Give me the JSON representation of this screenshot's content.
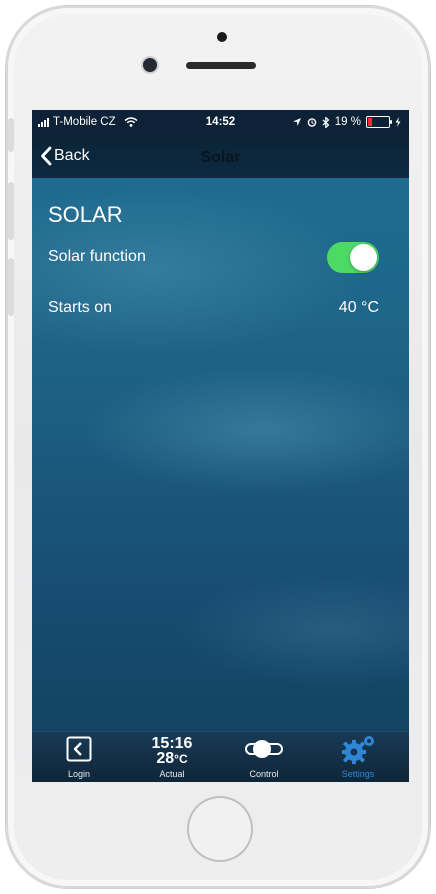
{
  "status_bar": {
    "carrier": "T-Mobile CZ",
    "time": "14:52",
    "battery_percent": "19 %",
    "battery_level": 0.19
  },
  "nav": {
    "back_label": "Back",
    "title": "Solar"
  },
  "content": {
    "section_title": "SOLAR",
    "solar_function": {
      "label": "Solar function",
      "enabled": true
    },
    "starts_on": {
      "label": "Starts on",
      "value": "40 °C"
    }
  },
  "tabbar": {
    "login": {
      "label": "Login"
    },
    "actual": {
      "time": "15:16",
      "temp": "28",
      "temp_unit": "°C",
      "label": "Actual"
    },
    "control": {
      "label": "Control"
    },
    "settings": {
      "label": "Settings",
      "active": true
    }
  },
  "colors": {
    "toggle_on": "#4cd964",
    "tab_active": "#2f86d6",
    "battery_low": "#ff2a36"
  },
  "icons": [
    "signal-icon",
    "wifi-icon",
    "location-icon",
    "alarm-icon",
    "bluetooth-icon",
    "battery-icon",
    "chevron-left-icon",
    "back-box-icon",
    "toggle-icon",
    "gear-icon"
  ]
}
